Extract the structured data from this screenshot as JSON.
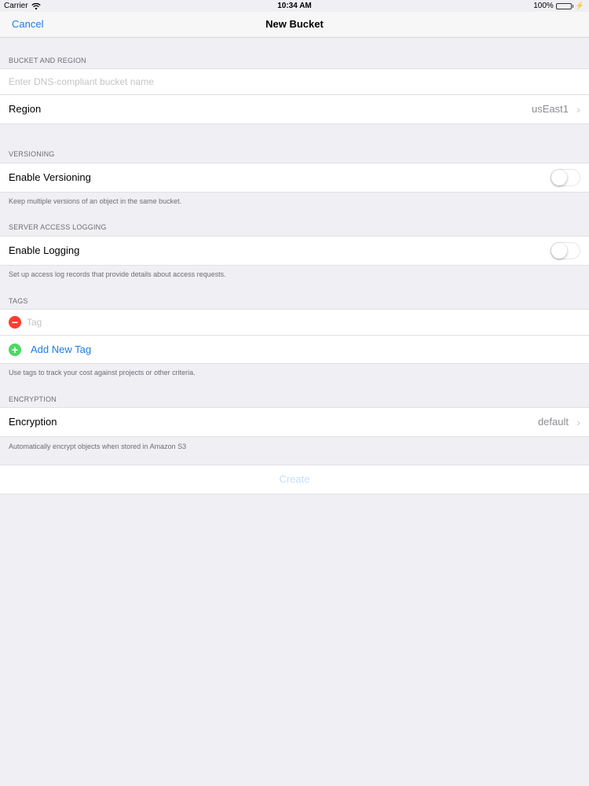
{
  "status_bar": {
    "carrier": "Carrier",
    "time": "10:34 AM",
    "battery_percent": "100%",
    "battery_level": 1.0,
    "battery_color": "#4cd964",
    "icons": [
      "wifi-icon",
      "battery-icon",
      "charging-bolt-icon"
    ]
  },
  "nav": {
    "cancel_label": "Cancel",
    "title": "New Bucket",
    "accent_color": "#1a7ee6"
  },
  "bucket_region": {
    "header": "BUCKET AND REGION",
    "name_placeholder": "Enter DNS-compliant bucket name",
    "name_value": "",
    "region_label": "Region",
    "region_value": "usEast1"
  },
  "versioning": {
    "header": "VERSIONING",
    "toggle_label": "Enable Versioning",
    "enabled": false,
    "footer": "Keep multiple versions of an object in the same bucket."
  },
  "logging": {
    "header": "SERVER ACCESS LOGGING",
    "toggle_label": "Enable Logging",
    "enabled": false,
    "footer": "Set up access log records that provide details about access requests."
  },
  "tags": {
    "header": "TAGS",
    "tag_placeholder": "Tag",
    "add_label": "Add New Tag",
    "footer": "Use tags to track your cost against projects or other criteria."
  },
  "encryption": {
    "header": "ENCRYPTION",
    "label": "Encryption",
    "value": "default",
    "footer": "Automatically encrypt objects when stored in Amazon S3"
  },
  "actions": {
    "create_label": "Create",
    "create_enabled": false
  }
}
